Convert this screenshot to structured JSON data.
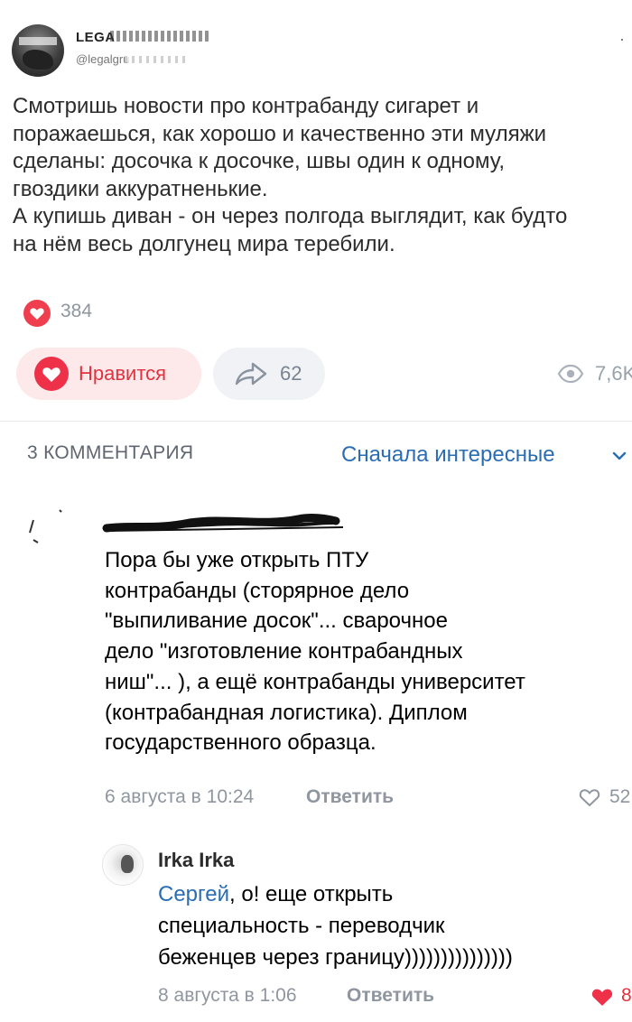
{
  "tweet": {
    "display_name": "LEGA",
    "handle": "@legalgru",
    "lines": [
      "Смотришь новости про контрабанду сигарет и",
      "поражаешься, как хорошо и качественно эти муляжи",
      "сделаны: досочка к досочке, швы один к одному,",
      "гвоздики аккуратненькие.",
      "А купишь диван - он через полгода выглядит, как будто",
      "на нём весь долгунец мира теребили."
    ]
  },
  "post": {
    "likes_count": "384",
    "like_button_label": "Нравится",
    "share_count": "62",
    "views_count": "7,6K"
  },
  "comments_header": {
    "count_label": "3 КОММЕНТАРИЯ",
    "sort_label": "Сначала интересные"
  },
  "comment1": {
    "lines": [
      "Пора бы уже открыть ПТУ",
      "контрабанды (сторярное дело",
      "\"выпиливание досок\"... сварочное",
      "дело \"изготовление контрабандных",
      "ниш\"... ), а ещё контрабанды университет",
      "(контрабандная логистика). Диплом",
      "государственного образца."
    ],
    "date": "6 августа в 10:24",
    "reply_label": "Ответить",
    "likes": "52"
  },
  "reply1": {
    "author": "Irka Irka",
    "mention": "Сергей",
    "line1_rest": ", о! еще открыть",
    "line2": "специальность - переводчик",
    "line3": "беженцев через границу)))))))))))))))",
    "date": "8 августа в 1:06",
    "reply_label": "Ответить",
    "likes": "8"
  },
  "icons": {
    "heart": "heart-icon",
    "share": "share-arrow-icon",
    "views": "eye-icon",
    "chevron": "chevron-down-icon"
  },
  "colors": {
    "accent_red": "#ee3148",
    "link_blue": "#2a6db3",
    "muted_gray": "#8f96a0"
  }
}
